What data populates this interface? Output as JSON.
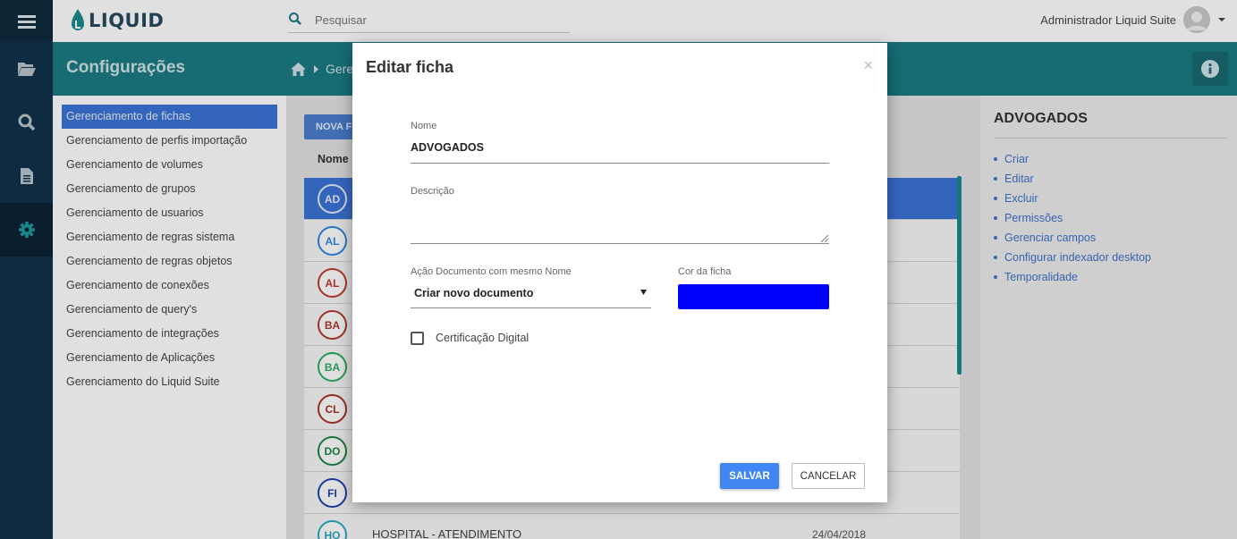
{
  "header": {
    "logo_text": "LIQUID",
    "search_placeholder": "Pesquisar",
    "user_name": "Administrador Liquid Suite"
  },
  "rail": {
    "items": [
      {
        "icon": "folder-open-icon"
      },
      {
        "icon": "search-icon"
      },
      {
        "icon": "document-icon"
      },
      {
        "icon": "gear-icon",
        "active": true
      }
    ]
  },
  "band": {
    "title": "Configurações",
    "breadcrumb": "Gerenc"
  },
  "submenu": {
    "items": [
      "Gerenciamento de fichas",
      "Gerenciamento de perfis importação",
      "Gerenciamento de volumes",
      "Gerenciamento de grupos",
      "Gerenciamento de usuarios",
      "Gerenciamento de regras sistema",
      "Gerenciamento de regras objetos",
      "Gerenciamento de conexões",
      "Gerenciamento de query's",
      "Gerenciamento de integrações",
      "Gerenciamento de Aplicações",
      "Gerenciamento do Liquid Suite"
    ],
    "active_index": 0
  },
  "main": {
    "new_button": "NOVA FI",
    "column_name": "Nome",
    "rows": [
      {
        "abbr": "AD",
        "color": "#3c74d8",
        "name": "",
        "date": ""
      },
      {
        "abbr": "AL",
        "color": "#2e86de",
        "name": "",
        "date": ""
      },
      {
        "abbr": "AL",
        "color": "#c0392b",
        "name": "",
        "date": ""
      },
      {
        "abbr": "BA",
        "color": "#b03a2e",
        "name": "",
        "date": ""
      },
      {
        "abbr": "BA",
        "color": "#27ae60",
        "name": "",
        "date": ""
      },
      {
        "abbr": "CL",
        "color": "#a93226",
        "name": "",
        "date": ""
      },
      {
        "abbr": "DO",
        "color": "#1e8449",
        "name": "",
        "date": ""
      },
      {
        "abbr": "FI",
        "color": "#1f3fb0",
        "name": "",
        "date": ""
      },
      {
        "abbr": "HO",
        "color": "#2aa7c0",
        "name": "HOSPITAL - ATENDIMENTO",
        "date": "24/04/2018"
      }
    ]
  },
  "right_panel": {
    "title": "ADVOGADOS",
    "links": [
      "Criar",
      "Editar",
      "Excluir",
      "Permissões",
      "Gerenciar campos",
      "Configurar indexador desktop",
      "Temporalidade"
    ]
  },
  "modal": {
    "title": "Editar ficha",
    "close": "×",
    "nome_label": "Nome",
    "nome_value": "ADVOGADOS",
    "descricao_label": "Descrição",
    "descricao_value": "",
    "acao_label": "Ação Documento com mesmo Nome",
    "acao_value": "Criar novo documento",
    "cor_label": "Cor da ficha",
    "cor_value": "#0000ff",
    "cert_label": "Certificação Digital",
    "cert_checked": false,
    "save_label": "SALVAR",
    "cancel_label": "CANCELAR"
  }
}
